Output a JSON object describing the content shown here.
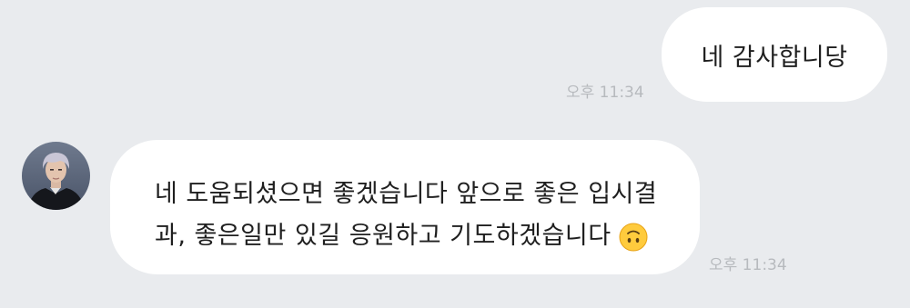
{
  "messages": {
    "outgoing": {
      "text": "네 감사합니당",
      "time": "오후 11:34"
    },
    "incoming": {
      "line1": "네 도움되셨으면 좋겠습니다 앞으로 좋은 입시결",
      "line2": "과, 좋은일만 있길 응원하고 기도하겠습니다",
      "emoji": "upside-down-face",
      "time": "오후 11:34"
    }
  },
  "colors": {
    "background": "#e9ebee",
    "bubble": "#ffffff",
    "timestamp": "#b7babe"
  }
}
